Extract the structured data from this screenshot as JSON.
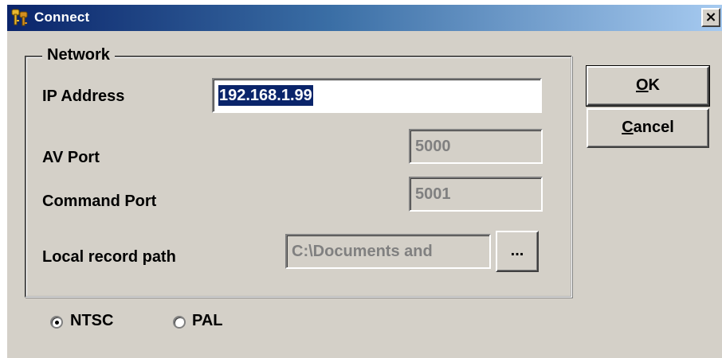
{
  "window": {
    "title": "Connect",
    "close_glyph": "×"
  },
  "network": {
    "legend": "Network",
    "ip_label": "IP Address",
    "ip_value": "192.168.1.99",
    "av_port_label": "AV Port",
    "av_port_value": "5000",
    "command_port_label": "Command Port",
    "command_port_value": "5001",
    "record_path_label": "Local record path",
    "record_path_value": "C:\\Documents and",
    "browse_label": "..."
  },
  "buttons": {
    "ok_hotkey": "O",
    "ok_rest": "K",
    "cancel_hotkey": "C",
    "cancel_rest": "ancel"
  },
  "video_standard": {
    "ntsc_label": "NTSC",
    "pal_label": "PAL",
    "selected": "NTSC"
  },
  "colors": {
    "face": "#d4d0c8",
    "title_start": "#0a246a",
    "title_end": "#a6caf0",
    "selection": "#0a246a"
  }
}
